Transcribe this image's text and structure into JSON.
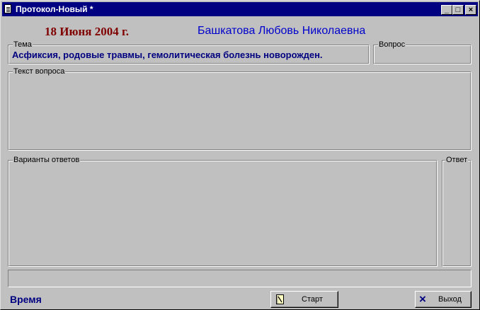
{
  "window": {
    "title": "Протокол-Новый *",
    "minimize_glyph": "_",
    "maximize_glyph": "□",
    "close_glyph": "×"
  },
  "header": {
    "date": "18 Июня 2004 г.",
    "person": "Башкатова Любовь Николаевна"
  },
  "theme": {
    "label": "Тема",
    "value": "Асфиксия, родовые травмы, гемолитическая болезнь новорожден."
  },
  "question_number": {
    "label": "Вопрос",
    "value": ""
  },
  "question_text": {
    "label": "Текст вопроса",
    "value": ""
  },
  "answer_options": {
    "label": "Варианты ответов",
    "value": ""
  },
  "answer": {
    "label": "Ответ",
    "value": ""
  },
  "status": {
    "value": ""
  },
  "footer": {
    "time_label": "Время",
    "start_button": "Старт",
    "exit_button": "Выход",
    "exit_icon": "×"
  },
  "colors": {
    "titlebar": "#000080",
    "date": "#800000",
    "person": "#0000cc",
    "theme_text": "#000080",
    "face": "#c0c0c0"
  }
}
